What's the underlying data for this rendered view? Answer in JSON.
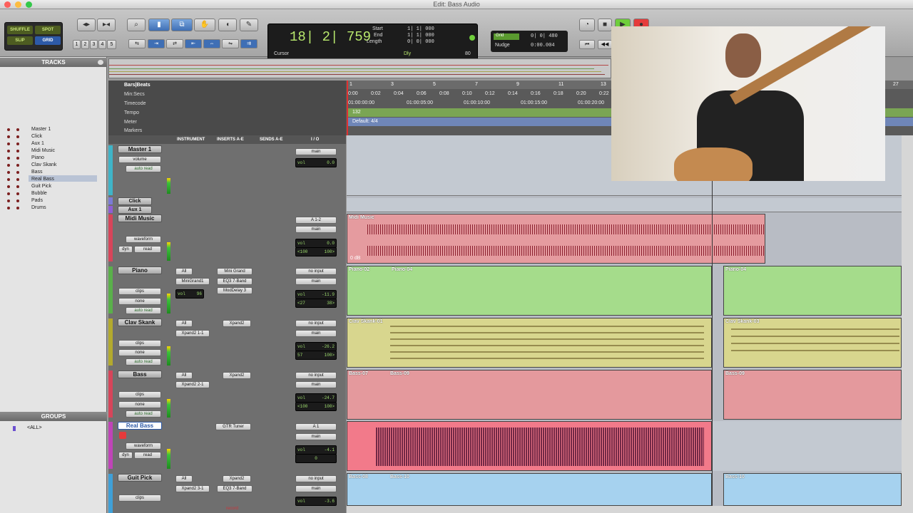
{
  "window": {
    "title": "Edit: Bass Audio"
  },
  "toolbar": {
    "modes": [
      "SHUFFLE",
      "SPOT",
      "SLIP",
      "GRID"
    ],
    "zoom_presets": [
      "1",
      "2",
      "3",
      "4",
      "5"
    ]
  },
  "counter": {
    "main": "18| 2| 759",
    "start_label": "Start",
    "end_label": "End",
    "length_label": "Length",
    "start": "1| 1| 000",
    "end": "1| 1| 000",
    "length": "0| 0| 000",
    "cursor_label": "Cursor",
    "dly_label": "Dly",
    "bpm": "80"
  },
  "grid": {
    "grid_label": "Grid",
    "grid_value": "0| 0| 480",
    "nudge_label": "Nudge",
    "nudge_value": "0:00.004"
  },
  "tracks_panel": {
    "header": "TRACKS",
    "items": [
      "Master 1",
      "Click",
      "Aux 1",
      "Midi Music",
      "Piano",
      "Clav Skank",
      "Bass",
      "Real Bass",
      "Guit Pick",
      "Bubble",
      "Pads",
      "Drums"
    ],
    "selected": "Real Bass"
  },
  "groups_panel": {
    "header": "GROUPS",
    "items": [
      "<ALL>"
    ]
  },
  "rulers": {
    "labels": [
      "Bars|Beats",
      "Min:Secs",
      "Timecode",
      "Tempo",
      "Meter",
      "Markers"
    ],
    "bars": [
      "1",
      "3",
      "5",
      "7",
      "9",
      "11",
      "13",
      "27"
    ],
    "minsecs": [
      "0:00",
      "0:02",
      "0:04",
      "0:06",
      "0:08",
      "0:10",
      "0:12",
      "0:14",
      "0:16",
      "0:18",
      "0:20",
      "0:22"
    ],
    "timecode": [
      "01:00:00:00",
      "01:00:05:00",
      "01:00:10:00",
      "01:00:15:00",
      "01:00:20:00"
    ],
    "tempo": "132",
    "meter": "Default: 4/4"
  },
  "mix_columns": {
    "instrument": "INSTRUMENT",
    "inserts": "INSERTS A-E",
    "sends": "SENDS A-E",
    "io": "I / O"
  },
  "mix": {
    "master": {
      "name": "Master 1",
      "volume": "volume",
      "auto": "auto read",
      "out": "main",
      "vol_label": "vol",
      "vol": "0.0"
    },
    "click": {
      "name": "Click"
    },
    "aux": {
      "name": "Aux 1"
    },
    "midi": {
      "name": "Midi Music",
      "view": "waveform",
      "dyn": "dyn",
      "read": "read",
      "in": "A 1-2",
      "out": "main",
      "vol_label": "vol",
      "vol": "0.0",
      "pan_l": "<100",
      "pan_r": "100>"
    },
    "piano": {
      "name": "Piano",
      "all": "All",
      "inst": "MiniGrand1",
      "ins": [
        "Mini Grand",
        "EQ3 7-Band",
        "ModDelay 3"
      ],
      "in": "no input",
      "out": "main",
      "vol_label": "vol",
      "vol": "-11.9",
      "pan_l": "<27",
      "pan_r": "38>",
      "ivol": "96",
      "ipan": "0",
      "view": "clips",
      "none": "none",
      "auto": "auto read"
    },
    "clav": {
      "name": "Clav Skank",
      "all": "All",
      "inst": "Xpand2 1-1",
      "ins": [
        "Xpand2"
      ],
      "in": "no input",
      "out": "main",
      "vol_label": "vol",
      "vol": "-26.2",
      "pan_l": "57",
      "pan_r": "100>",
      "ivol": "96",
      "ipan": "0",
      "view": "clips",
      "none": "none",
      "auto": "auto read"
    },
    "bass": {
      "name": "Bass",
      "all": "All",
      "inst": "Xpand2 2-1",
      "ins": [
        "Xpand2"
      ],
      "in": "no input",
      "out": "main",
      "vol_label": "vol",
      "vol": "-24.7",
      "pan_l": "<100",
      "pan_r": "100>",
      "ivol": "96",
      "ipan": "0",
      "view": "clips",
      "none": "none",
      "auto": "auto read"
    },
    "realbass": {
      "name": "Real Bass",
      "ins": [
        "GTR Tuner"
      ],
      "in": "A 1",
      "out": "main",
      "vol_label": "vol",
      "vol": "-4.1",
      "pan": "0",
      "view": "waveform",
      "dyn": "dyn",
      "read": "read"
    },
    "guit": {
      "name": "Guit Pick",
      "all": "All",
      "inst": "Xpand2 3-1",
      "ins": [
        "Xpand2",
        "EQ3 7-Band"
      ],
      "in": "no input",
      "out": "main",
      "vol_label": "vol",
      "vol": "-3.6",
      "ivol": "96",
      "view": "clips"
    },
    "record_label": "record"
  },
  "clips": {
    "midi": "Midi Music",
    "midi_gain": "0 dB",
    "piano": [
      "Piano-02",
      "Piano-04",
      "Piano-04"
    ],
    "clav": [
      "Clav Skank-01",
      "Clav Skank-03"
    ],
    "bass": [
      "Bass-07",
      "Bass-09",
      "Bass-09"
    ],
    "guit": [
      "Bass-08",
      "Bass-10",
      "Bass-10"
    ]
  },
  "colors": {
    "audio_clip": "#e59b9f",
    "audio_wave": "#8a1f2e",
    "piano": "#a5dc8b",
    "clav": "#d8d68e",
    "bass": "#e4999d",
    "realbass": "#f27a8a",
    "realbass_wave": "#5b1a3a",
    "guit": "#a6d2ef",
    "accent": "#4a78c7"
  }
}
